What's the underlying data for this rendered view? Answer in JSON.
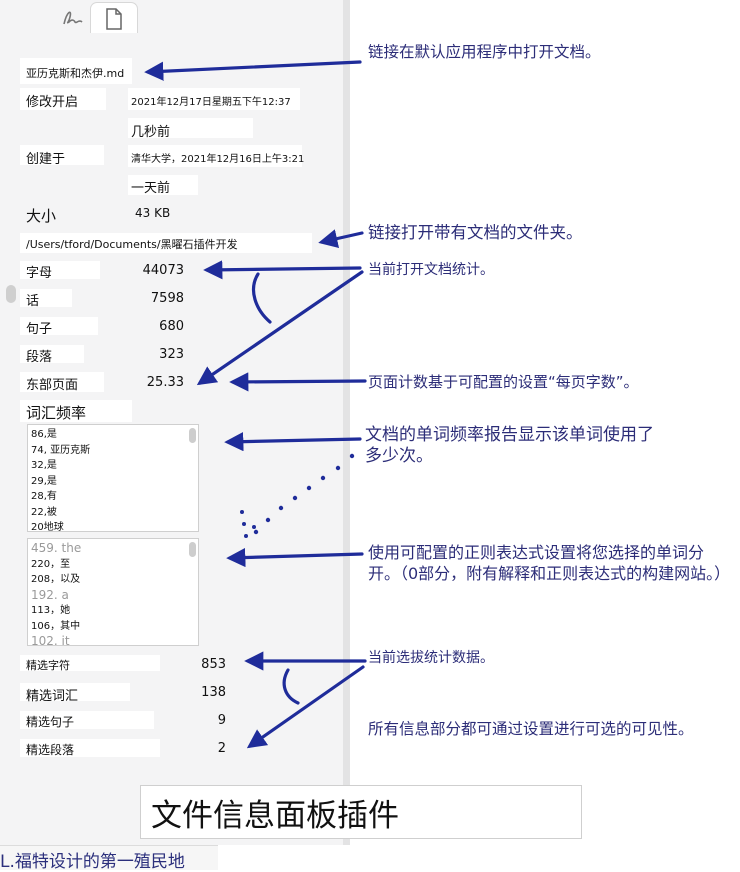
{
  "panel": {
    "tabs": [
      {
        "name": "links-tab",
        "icon": "signature-icon"
      },
      {
        "name": "file-info-tab",
        "icon": "document-icon"
      }
    ],
    "file_name": "亚历克斯和杰伊.md",
    "modified_label": "修改开启",
    "modified_value": "2021年12月17日星期五下午12:37",
    "modified_relative": "几秒前",
    "created_label": "创建于",
    "created_value": "清华大学，2021年12月16日上午3:21",
    "created_relative": "一天前",
    "size_label": "大小",
    "size_value": "43 KB",
    "folder_path": "/Users/tford/Documents/黑曜石插件开发",
    "stats": [
      {
        "label": "字母",
        "value": "44073"
      },
      {
        "label": "话",
        "value": "7598"
      },
      {
        "label": "句子",
        "value": "680"
      },
      {
        "label": "段落",
        "value": "323"
      },
      {
        "label": "东部页面",
        "value": "25.33"
      }
    ],
    "freq_heading": "词汇频率",
    "freq_list_1": [
      "86,是",
      "74, 亚历克斯",
      "32,是",
      "29,是",
      "28,有",
      "22,被",
      "20地球"
    ],
    "freq_list_2": [
      {
        "text": "459. the",
        "gray": true
      },
      {
        "text": "220，至",
        "gray": false
      },
      {
        "text": "208，以及",
        "gray": false
      },
      {
        "text": "192. a",
        "gray": true
      },
      {
        "text": "113，她",
        "gray": false
      },
      {
        "text": "106，其中",
        "gray": false
      },
      {
        "text": "102. it",
        "gray": true
      }
    ],
    "selection_stats": [
      {
        "label": "精选字符",
        "value": "853"
      },
      {
        "label": "精选词汇",
        "value": "138"
      },
      {
        "label": "精选句子",
        "value": "9"
      },
      {
        "label": "精选段落",
        "value": "2"
      }
    ]
  },
  "annotations": {
    "open_default_app": "链接在默认应用程序中打开文档。",
    "open_folder": "链接打开带有文档的文件夹。",
    "current_doc_stats": "当前打开文档统计。",
    "page_count_setting": "页面计数基于可配置的设置“每页字数”。",
    "word_freq_report": "文档的单词频率报告显示该单词使用了多少次。",
    "regex_split": "使用可配置的正则表达式设置将您选择的单词分开。（0部分，附有解释和正则表达式的构建网站。）",
    "selection_stats": "当前选拔统计数据。",
    "visibility": "所有信息部分都可通过设置进行可选的可见性。"
  },
  "title": "文件信息面板插件",
  "footer": "L.福特设计的第一殖民地",
  "colors": {
    "annotation": "#2c2d78",
    "arrow": "#1f2c9a",
    "panel_bg": "#f4f4f5"
  }
}
